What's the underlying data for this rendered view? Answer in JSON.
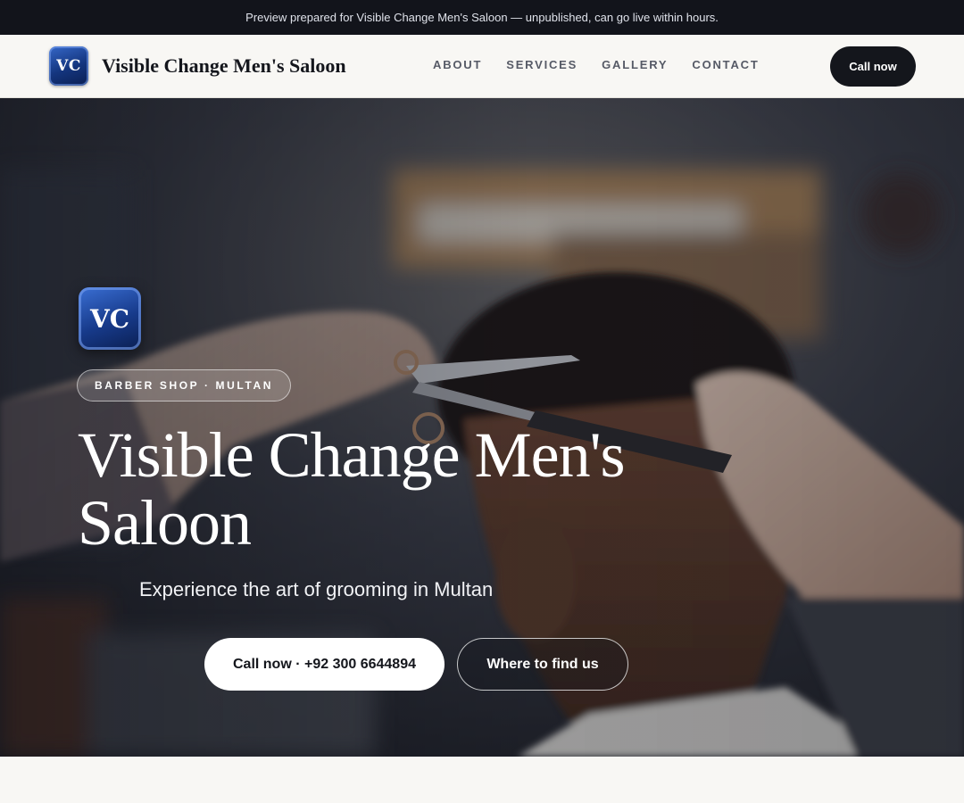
{
  "preview_banner": {
    "text": "Preview prepared for Visible Change Men's Saloon — unpublished, can go live within hours."
  },
  "header": {
    "logo_text": "VC",
    "brand_name": "Visible Change Men's Saloon",
    "nav": [
      {
        "label": "ABOUT"
      },
      {
        "label": "SERVICES"
      },
      {
        "label": "GALLERY"
      },
      {
        "label": "CONTACT"
      }
    ],
    "call_button": "Call now"
  },
  "hero": {
    "logo_text": "VC",
    "chip": "BARBER SHOP · MULTAN",
    "title": "Visible Change Men's Saloon",
    "subtitle": "Experience the art of grooming in Multan",
    "primary_button": "Call now · +92 300 6644894",
    "secondary_button": "Where to find us"
  },
  "colors": {
    "dark": "#14161c",
    "preview_bar": "#12141b",
    "page_bg": "#f8f7f4",
    "logo_blue": "#173a8a",
    "nav_text": "#565a66"
  },
  "icons": {
    "logo": "vc-monogram-icon"
  }
}
